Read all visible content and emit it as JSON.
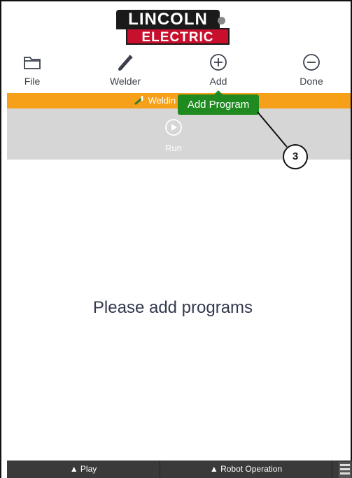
{
  "brand": {
    "line1": "LINCOLN",
    "line2": "ELECTRIC"
  },
  "toolbar": [
    {
      "label": "File",
      "icon": "folder-icon"
    },
    {
      "label": "Welder",
      "icon": "welder-icon"
    },
    {
      "label": "Add",
      "icon": "plus-circle-icon"
    },
    {
      "label": "Done",
      "icon": "minus-circle-icon"
    }
  ],
  "status_bar": {
    "text": "Weldin",
    "color": "#f6a01a"
  },
  "run": {
    "label": "Run",
    "icon": "play-circle-icon"
  },
  "tooltip": {
    "text": "Add Program",
    "color": "#1f8a1f"
  },
  "callout": {
    "number": "3"
  },
  "message": "Please add programs",
  "bottom_bar": {
    "play": "▲ Play",
    "robot_operation": "▲ Robot Operation"
  }
}
